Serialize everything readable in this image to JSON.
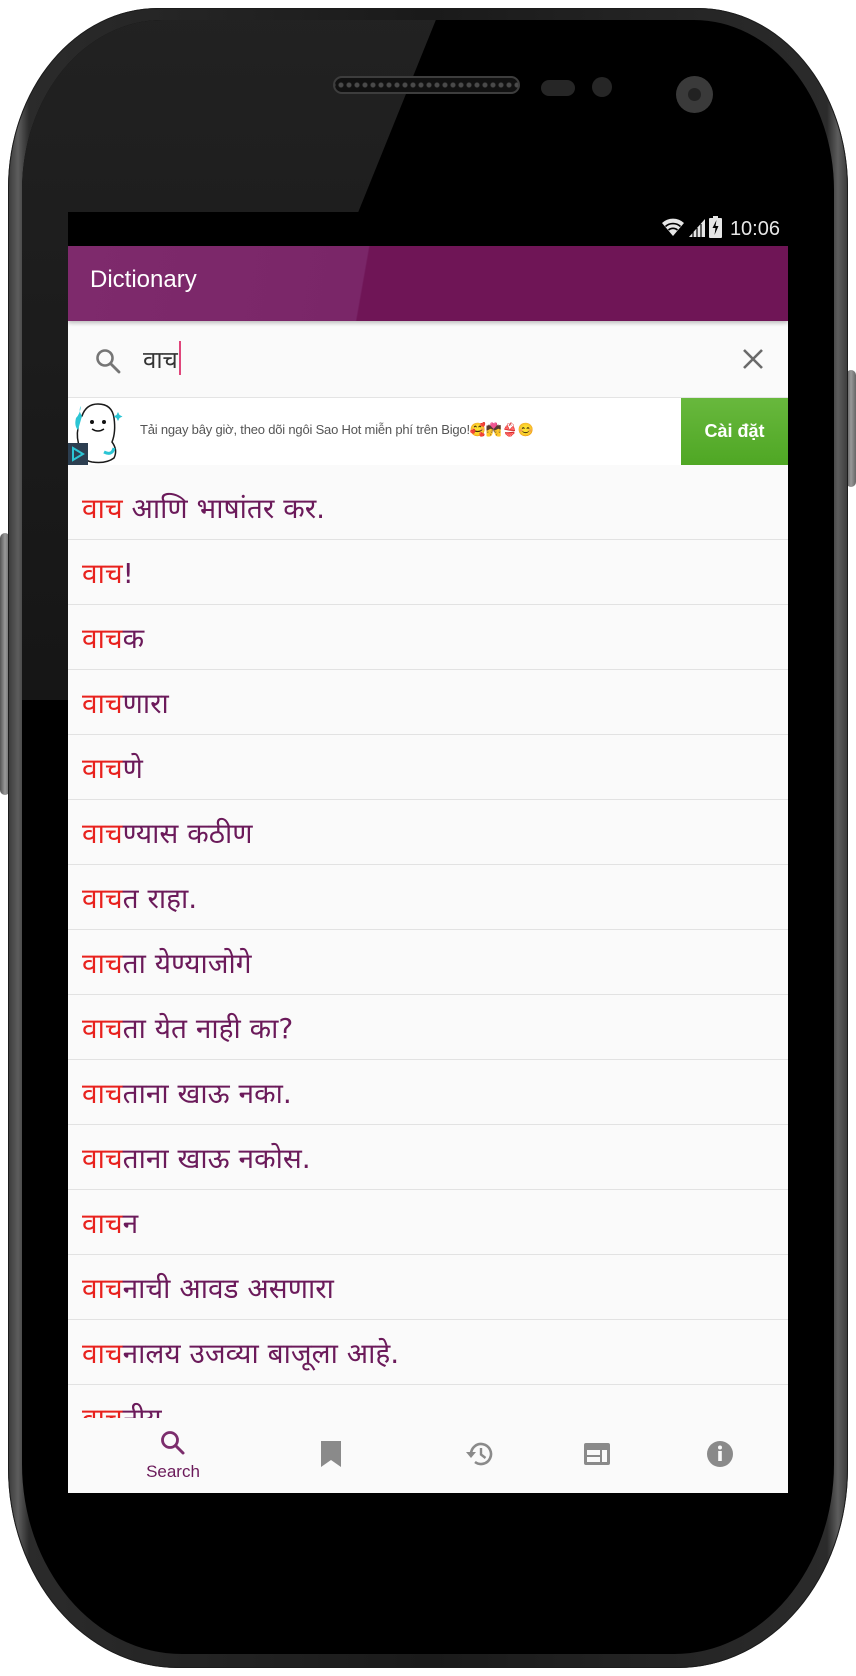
{
  "status_bar": {
    "time": "10:06",
    "icons": [
      "wifi-icon",
      "signal-icon",
      "battery-charging-icon"
    ]
  },
  "app_bar": {
    "title": "Dictionary"
  },
  "search": {
    "value": "वाच",
    "placeholder": "",
    "icon": "search-icon",
    "clear_icon": "close-icon"
  },
  "ad": {
    "text": "Tải ngay bây giờ, theo dõi ngôi Sao Hot miễn phí trên Bigo!🥰💏👙😊",
    "cta_label": "Cài đặt",
    "cta_color": "#5aae2e",
    "logo": "bigo-mascot-icon",
    "badge": "ad-choices-icon"
  },
  "results": {
    "highlight_color": "#e8211d",
    "text_color": "#6b1a5a",
    "items": [
      {
        "match": "वाच",
        "rest": " आणि भाषांतर कर."
      },
      {
        "match": "वाच",
        "rest": "!"
      },
      {
        "match": "वाच",
        "rest": "क"
      },
      {
        "match": "वाच",
        "rest": "णारा"
      },
      {
        "match": "वाच",
        "rest": "णे"
      },
      {
        "match": "वाच",
        "rest": "ण्यास कठीण"
      },
      {
        "match": "वाच",
        "rest": "त राहा."
      },
      {
        "match": "वाच",
        "rest": "ता येण्याजोगे"
      },
      {
        "match": "वाच",
        "rest": "ता येत नाही का?"
      },
      {
        "match": "वाच",
        "rest": "ताना खाऊ नका."
      },
      {
        "match": "वाच",
        "rest": "ताना खाऊ नकोस."
      },
      {
        "match": "वाच",
        "rest": "न"
      },
      {
        "match": "वाच",
        "rest": "नाची आवड असणारा"
      },
      {
        "match": "वाच",
        "rest": "नालय उजव्या बाजूला आहे."
      },
      {
        "match": "वाच",
        "rest": "नीय"
      }
    ]
  },
  "bottom_nav": {
    "active_color": "#7b2d6c",
    "inactive_color": "#8a8a8a",
    "items": [
      {
        "label": "Search",
        "icon": "search-icon",
        "active": true
      },
      {
        "label": "",
        "icon": "bookmark-icon",
        "active": false
      },
      {
        "label": "",
        "icon": "history-icon",
        "active": false
      },
      {
        "label": "",
        "icon": "flashcard-icon",
        "active": false
      },
      {
        "label": "",
        "icon": "info-icon",
        "active": false
      }
    ]
  },
  "theme": {
    "primary": "#6f1556",
    "primary_light": "#7e2a6c"
  }
}
